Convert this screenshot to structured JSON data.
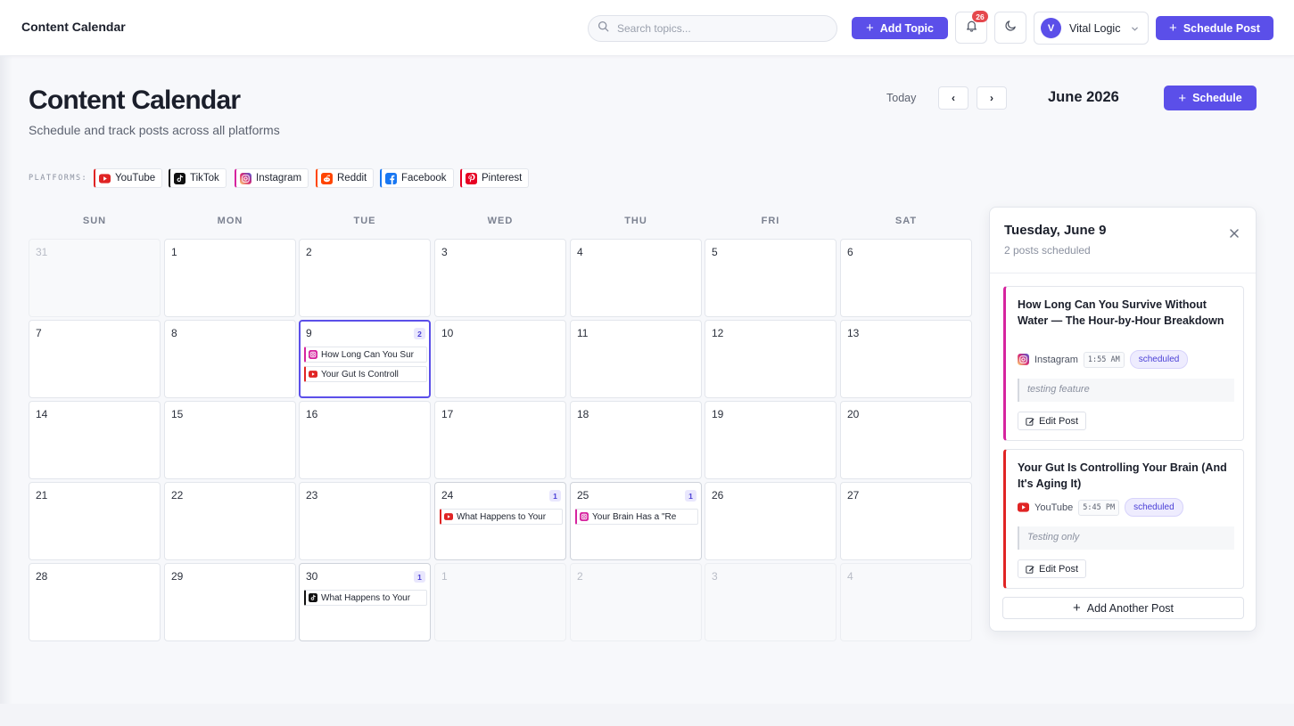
{
  "header": {
    "app_title": "Content Calendar",
    "search_placeholder": "Search topics...",
    "add_topic_label": "Add Topic",
    "notification_count": "26",
    "user_initial": "V",
    "user_name": "Vital Logic",
    "schedule_post_label": "Schedule Post"
  },
  "page": {
    "title": "Content Calendar",
    "subtitle": "Schedule and track posts across all platforms",
    "today_label": "Today",
    "prev_label": "‹",
    "next_label": "›",
    "month_label": "June 2026",
    "schedule_label": "Schedule"
  },
  "platforms": {
    "label": "PLATFORMS:",
    "items": [
      {
        "name": "YouTube",
        "color": "#e02424"
      },
      {
        "name": "TikTok",
        "color": "#111111"
      },
      {
        "name": "Instagram",
        "color": "#d6249f"
      },
      {
        "name": "Reddit",
        "color": "#ff4500"
      },
      {
        "name": "Facebook",
        "color": "#1877f2"
      },
      {
        "name": "Pinterest",
        "color": "#e60023"
      }
    ]
  },
  "calendar": {
    "weekdays": [
      "SUN",
      "MON",
      "TUE",
      "WED",
      "THU",
      "FRI",
      "SAT"
    ],
    "days": [
      {
        "num": "31",
        "muted": true
      },
      {
        "num": "1"
      },
      {
        "num": "2"
      },
      {
        "num": "3"
      },
      {
        "num": "4"
      },
      {
        "num": "5"
      },
      {
        "num": "6"
      },
      {
        "num": "7"
      },
      {
        "num": "8"
      },
      {
        "num": "9",
        "selected": true,
        "count": "2",
        "posts": [
          {
            "platform": "instagram",
            "title": "How Long Can You Sur"
          },
          {
            "platform": "youtube",
            "title": "Your Gut Is Controll"
          }
        ]
      },
      {
        "num": "10"
      },
      {
        "num": "11"
      },
      {
        "num": "12"
      },
      {
        "num": "13"
      },
      {
        "num": "14"
      },
      {
        "num": "15"
      },
      {
        "num": "16"
      },
      {
        "num": "17"
      },
      {
        "num": "18"
      },
      {
        "num": "19"
      },
      {
        "num": "20"
      },
      {
        "num": "21"
      },
      {
        "num": "22"
      },
      {
        "num": "23"
      },
      {
        "num": "24",
        "count": "1",
        "posts": [
          {
            "platform": "youtube",
            "title": "What Happens to Your"
          }
        ]
      },
      {
        "num": "25",
        "count": "1",
        "posts": [
          {
            "platform": "instagram",
            "title": "Your Brain Has a \"Re"
          }
        ]
      },
      {
        "num": "26"
      },
      {
        "num": "27"
      },
      {
        "num": "28"
      },
      {
        "num": "29"
      },
      {
        "num": "30",
        "count": "1",
        "posts": [
          {
            "platform": "tiktok",
            "title": "What Happens to Your"
          }
        ]
      },
      {
        "num": "1",
        "muted": true
      },
      {
        "num": "2",
        "muted": true
      },
      {
        "num": "3",
        "muted": true
      },
      {
        "num": "4",
        "muted": true
      }
    ]
  },
  "panel": {
    "title": "Tuesday, June 9",
    "subtitle": "2 posts scheduled",
    "posts": [
      {
        "title": "How Long Can You Survive Without Water — The Hour-by-Hour Breakdown",
        "platform": "Instagram",
        "platform_key": "instagram",
        "time": "1:55 AM",
        "status": "scheduled",
        "note": "testing feature",
        "edit_label": "Edit Post"
      },
      {
        "title": "Your Gut Is Controlling Your Brain (And It's Aging It)",
        "platform": "YouTube",
        "platform_key": "youtube",
        "time": "5:45 PM",
        "status": "scheduled",
        "note": "Testing only",
        "edit_label": "Edit Post"
      }
    ],
    "add_another_label": "Add Another Post"
  },
  "colors": {
    "accent": "#5b4fe9",
    "post_border": "#e02424"
  }
}
